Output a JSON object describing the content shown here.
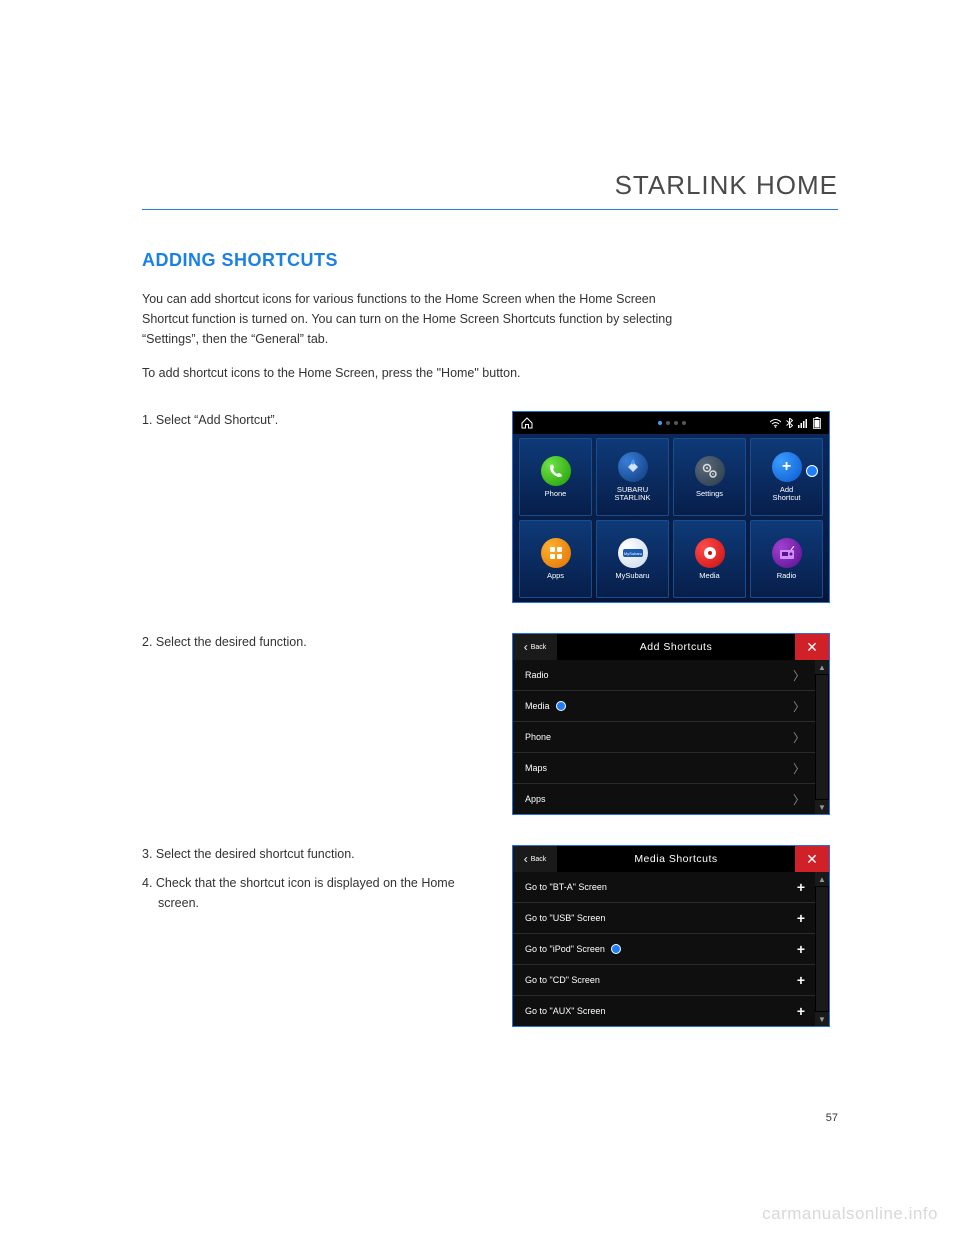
{
  "chapter": "STARLINK HOME",
  "section_title": "ADDING SHORTCUTS",
  "intro1": "You can add shortcut icons for various functions to the Home Screen when the Home Screen Shortcut function is turned on. You can turn on the Home Screen Shortcuts function by selecting “Settings”, then the “General” tab.",
  "intro2": "To add shortcut icons to the Home Screen, press the \"Home\" button.",
  "steps": {
    "s1": "1.  Select “Add Shortcut”.",
    "s2": "2.  Select the desired function.",
    "s3": "3.  Select the desired shortcut function.",
    "s4": "4.  Check that the shortcut icon is displayed on the Home screen."
  },
  "fig1": {
    "tiles": [
      {
        "label": "Phone"
      },
      {
        "label": "SUBARU\nSTARLINK"
      },
      {
        "label": "Settings"
      },
      {
        "label": "Add\nShortcut"
      },
      {
        "label": "Apps"
      },
      {
        "label": "MySubaru"
      },
      {
        "label": "Media"
      },
      {
        "label": "Radio"
      }
    ]
  },
  "fig2": {
    "back": "Back",
    "title": "Add Shortcuts",
    "items": [
      "Radio",
      "Media",
      "Phone",
      "Maps",
      "Apps"
    ]
  },
  "fig3": {
    "back": "Back",
    "title": "Media Shortcuts",
    "items": [
      "Go to \"BT-A\" Screen",
      "Go to \"USB\" Screen",
      "Go to \"iPod\" Screen",
      "Go to \"CD\" Screen",
      "Go to \"AUX\" Screen"
    ]
  },
  "page_number": "57",
  "watermark": "carmanualsonline.info"
}
